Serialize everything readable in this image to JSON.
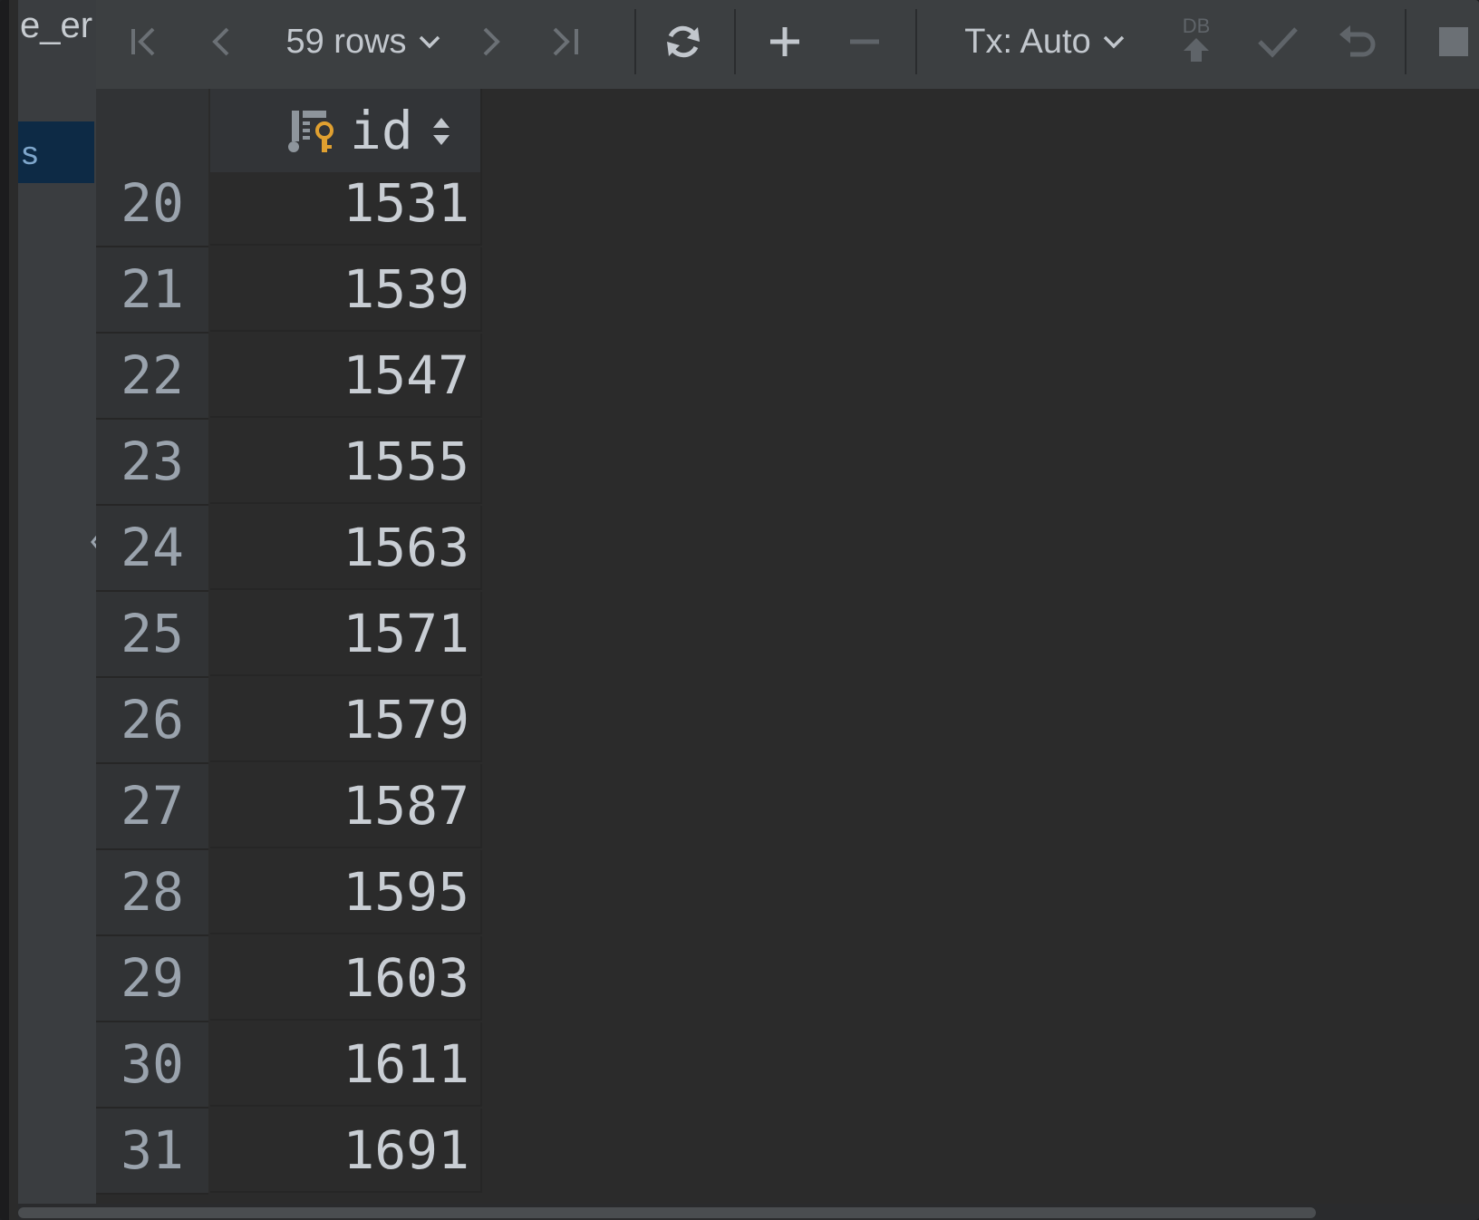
{
  "left_panel": {
    "title_fragment": "e_er",
    "selected_item_fragment": "s"
  },
  "toolbar": {
    "row_count_label": "59 rows",
    "tx_label": "Tx: Auto",
    "db_badge": "DB"
  },
  "grid": {
    "columns": [
      {
        "name": "id",
        "key": true
      }
    ],
    "rows": [
      {
        "n": "20",
        "id": "1531"
      },
      {
        "n": "21",
        "id": "1539"
      },
      {
        "n": "22",
        "id": "1547"
      },
      {
        "n": "23",
        "id": "1555"
      },
      {
        "n": "24",
        "id": "1563"
      },
      {
        "n": "25",
        "id": "1571"
      },
      {
        "n": "26",
        "id": "1579"
      },
      {
        "n": "27",
        "id": "1587"
      },
      {
        "n": "28",
        "id": "1595"
      },
      {
        "n": "29",
        "id": "1603"
      },
      {
        "n": "30",
        "id": "1611"
      },
      {
        "n": "31",
        "id": "1691"
      }
    ]
  },
  "colors": {
    "toolbar_bg": "#3c3f41",
    "grid_bg": "#2b2b2b",
    "key_icon": "#e0a030",
    "selection_bg": "#0d2a45"
  }
}
